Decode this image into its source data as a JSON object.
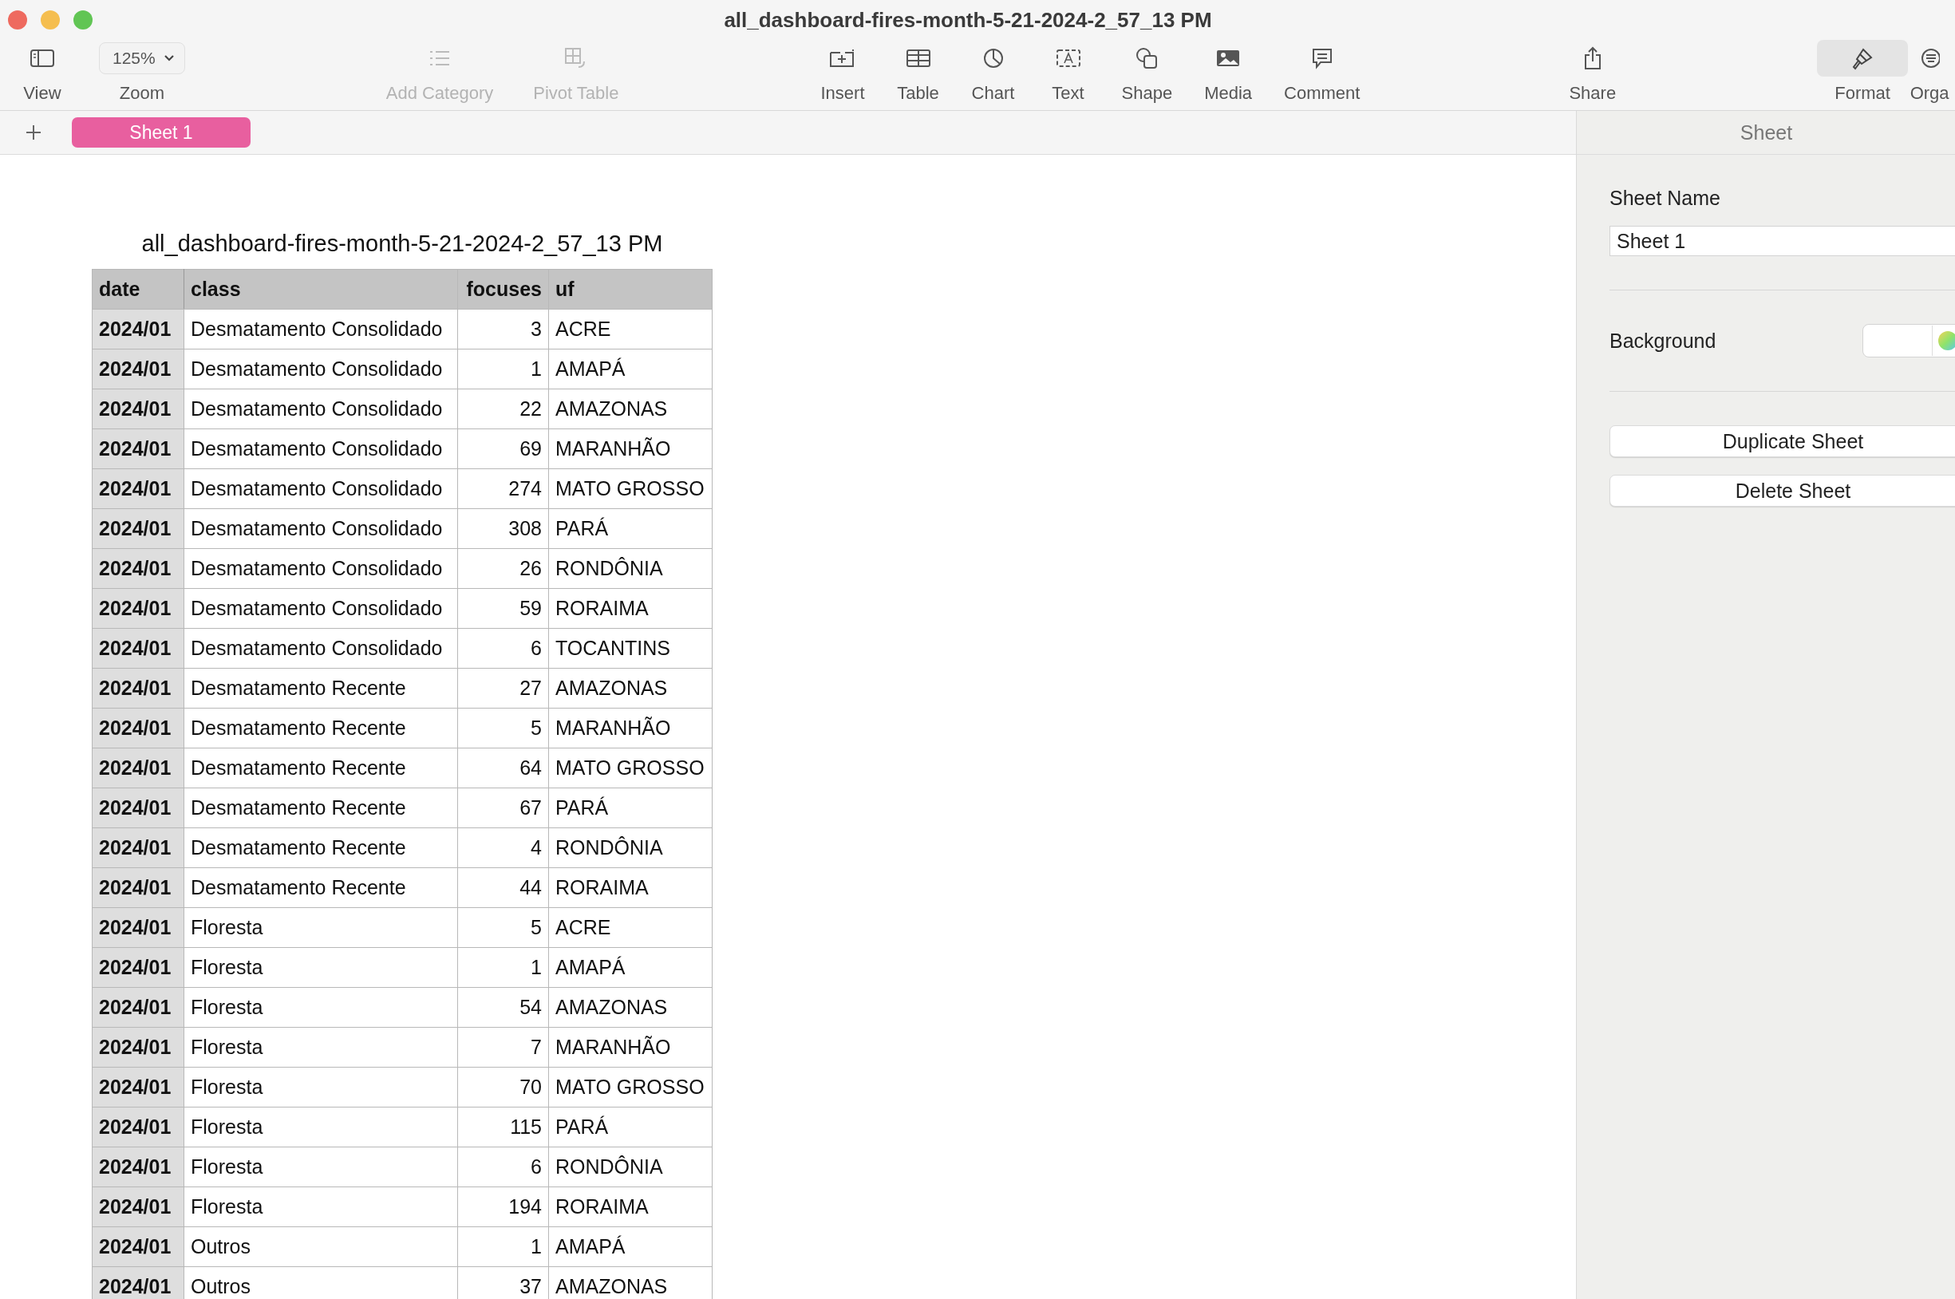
{
  "window": {
    "title": "all_dashboard-fires-month-5-21-2024-2_57_13 PM"
  },
  "toolbar": {
    "groups": [
      [
        {
          "label": "View",
          "kind": "sidebar",
          "disabled": false,
          "selected": false
        },
        {
          "label": "Zoom",
          "kind": "zoom",
          "value": "125%",
          "disabled": false,
          "selected": false
        }
      ],
      [
        {
          "label": "Add Category",
          "kind": "list",
          "disabled": true,
          "selected": false
        },
        {
          "label": "Pivot Table",
          "kind": "pivot",
          "disabled": true,
          "selected": false
        }
      ],
      [
        {
          "label": "Insert",
          "kind": "insert",
          "disabled": false,
          "selected": false
        },
        {
          "label": "Table",
          "kind": "table",
          "disabled": false,
          "selected": false
        },
        {
          "label": "Chart",
          "kind": "chart",
          "disabled": false,
          "selected": false
        },
        {
          "label": "Text",
          "kind": "text",
          "disabled": false,
          "selected": false
        },
        {
          "label": "Shape",
          "kind": "shape",
          "disabled": false,
          "selected": false
        },
        {
          "label": "Media",
          "kind": "media",
          "disabled": false,
          "selected": false
        },
        {
          "label": "Comment",
          "kind": "comment",
          "disabled": false,
          "selected": false
        }
      ],
      [
        {
          "label": "Share",
          "kind": "share",
          "disabled": false,
          "selected": false
        }
      ],
      [
        {
          "label": "Format",
          "kind": "brush",
          "disabled": false,
          "selected": true
        },
        {
          "label": "Orga",
          "kind": "organize",
          "disabled": false,
          "selected": false
        }
      ]
    ]
  },
  "sheet_tabs": [
    {
      "label": "Sheet 1",
      "selected": true
    }
  ],
  "table": {
    "title": "all_dashboard-fires-month-5-21-2024-2_57_13 PM",
    "columns": [
      "date",
      "class",
      "focuses",
      "uf"
    ],
    "rows": [
      [
        "2024/01",
        "Desmatamento Consolidado",
        "3",
        "ACRE"
      ],
      [
        "2024/01",
        "Desmatamento Consolidado",
        "1",
        "AMAPÁ"
      ],
      [
        "2024/01",
        "Desmatamento Consolidado",
        "22",
        "AMAZONAS"
      ],
      [
        "2024/01",
        "Desmatamento Consolidado",
        "69",
        "MARANHÃO"
      ],
      [
        "2024/01",
        "Desmatamento Consolidado",
        "274",
        "MATO GROSSO"
      ],
      [
        "2024/01",
        "Desmatamento Consolidado",
        "308",
        "PARÁ"
      ],
      [
        "2024/01",
        "Desmatamento Consolidado",
        "26",
        "RONDÔNIA"
      ],
      [
        "2024/01",
        "Desmatamento Consolidado",
        "59",
        "RORAIMA"
      ],
      [
        "2024/01",
        "Desmatamento Consolidado",
        "6",
        "TOCANTINS"
      ],
      [
        "2024/01",
        "Desmatamento Recente",
        "27",
        "AMAZONAS"
      ],
      [
        "2024/01",
        "Desmatamento Recente",
        "5",
        "MARANHÃO"
      ],
      [
        "2024/01",
        "Desmatamento Recente",
        "64",
        "MATO GROSSO"
      ],
      [
        "2024/01",
        "Desmatamento Recente",
        "67",
        "PARÁ"
      ],
      [
        "2024/01",
        "Desmatamento Recente",
        "4",
        "RONDÔNIA"
      ],
      [
        "2024/01",
        "Desmatamento Recente",
        "44",
        "RORAIMA"
      ],
      [
        "2024/01",
        "Floresta",
        "5",
        "ACRE"
      ],
      [
        "2024/01",
        "Floresta",
        "1",
        "AMAPÁ"
      ],
      [
        "2024/01",
        "Floresta",
        "54",
        "AMAZONAS"
      ],
      [
        "2024/01",
        "Floresta",
        "7",
        "MARANHÃO"
      ],
      [
        "2024/01",
        "Floresta",
        "70",
        "MATO GROSSO"
      ],
      [
        "2024/01",
        "Floresta",
        "115",
        "PARÁ"
      ],
      [
        "2024/01",
        "Floresta",
        "6",
        "RONDÔNIA"
      ],
      [
        "2024/01",
        "Floresta",
        "194",
        "RORAIMA"
      ],
      [
        "2024/01",
        "Outros",
        "1",
        "AMAPÁ"
      ],
      [
        "2024/01",
        "Outros",
        "37",
        "AMAZONAS"
      ]
    ]
  },
  "sidebar": {
    "title": "Sheet",
    "sheet_name_label": "Sheet Name",
    "sheet_name_value": "Sheet 1",
    "background_label": "Background",
    "buttons": [
      "Duplicate Sheet",
      "Delete Sheet"
    ]
  }
}
